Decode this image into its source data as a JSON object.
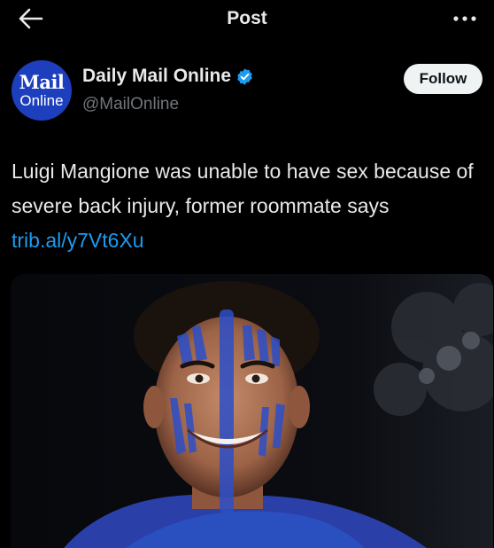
{
  "topbar": {
    "title": "Post",
    "back_icon": "arrow-left-icon",
    "more_icon": "more-horizontal-icon"
  },
  "author": {
    "display_name": "Daily Mail Online",
    "handle": "@MailOnline",
    "verified": true,
    "avatar_text_line1": "Mail",
    "avatar_text_line2": "Online",
    "avatar_color": "#1d3fbd",
    "verified_color": "#1d9bf0"
  },
  "follow_button": {
    "label": "Follow"
  },
  "tweet": {
    "text": "Luigi Mangione was unable to have sex because of severe back injury, former roommate says ",
    "link": "trib.al/y7Vt6Xu"
  },
  "media": {
    "kind": "photo"
  },
  "colors": {
    "background": "#000000",
    "text": "#e7e9ea",
    "secondary": "#71767b",
    "link": "#1d9bf0"
  }
}
